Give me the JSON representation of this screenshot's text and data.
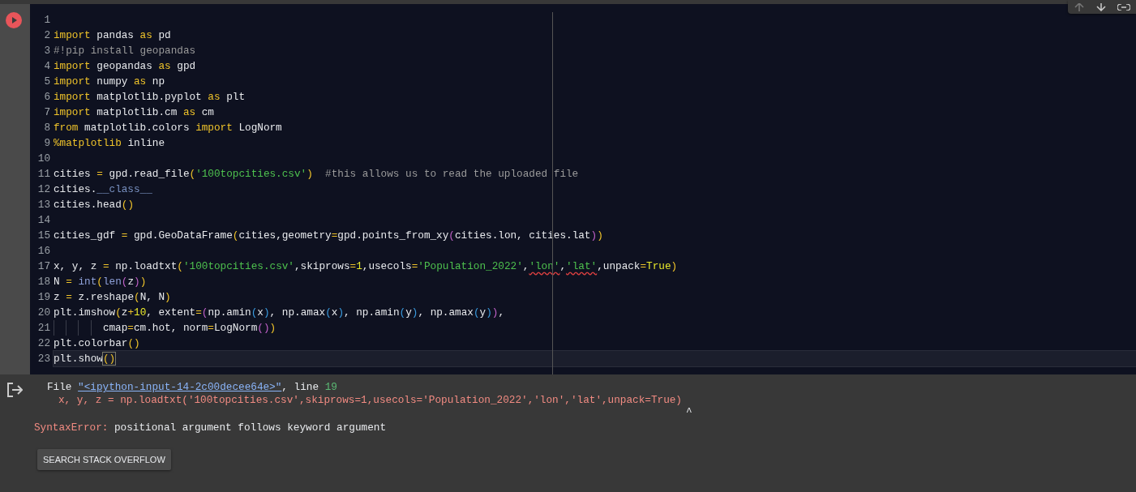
{
  "cell": {
    "code_lines": [
      {
        "number": "1",
        "current": false
      },
      {
        "number": "2",
        "current": false,
        "tokens": [
          {
            "text": "import",
            "kind": "kw"
          },
          {
            "text": " pandas ",
            "kind": "plain"
          },
          {
            "text": "as",
            "kind": "kw"
          },
          {
            "text": " pd",
            "kind": "plain"
          }
        ]
      },
      {
        "number": "3",
        "current": false,
        "tokens": [
          {
            "text": "#!pip install geopandas",
            "kind": "comment"
          }
        ]
      },
      {
        "number": "4",
        "current": false,
        "tokens": [
          {
            "text": "import",
            "kind": "kw"
          },
          {
            "text": " geopandas ",
            "kind": "plain"
          },
          {
            "text": "as",
            "kind": "kw"
          },
          {
            "text": " gpd",
            "kind": "plain"
          }
        ]
      },
      {
        "number": "5",
        "current": false,
        "tokens": [
          {
            "text": "import",
            "kind": "kw"
          },
          {
            "text": " numpy ",
            "kind": "plain"
          },
          {
            "text": "as",
            "kind": "kw"
          },
          {
            "text": " np",
            "kind": "plain"
          }
        ]
      },
      {
        "number": "6",
        "current": false,
        "tokens": [
          {
            "text": "import",
            "kind": "kw"
          },
          {
            "text": " matplotlib.pyplot ",
            "kind": "plain"
          },
          {
            "text": "as",
            "kind": "kw"
          },
          {
            "text": " plt",
            "kind": "plain"
          }
        ]
      },
      {
        "number": "7",
        "current": false,
        "tokens": [
          {
            "text": "import",
            "kind": "kw"
          },
          {
            "text": " matplotlib.cm ",
            "kind": "plain"
          },
          {
            "text": "as",
            "kind": "kw"
          },
          {
            "text": " cm",
            "kind": "plain"
          }
        ]
      },
      {
        "number": "8",
        "current": false,
        "tokens": [
          {
            "text": "from",
            "kind": "kw"
          },
          {
            "text": " matplotlib.colors ",
            "kind": "plain"
          },
          {
            "text": "import",
            "kind": "kw"
          },
          {
            "text": " LogNorm",
            "kind": "plain"
          }
        ]
      },
      {
        "number": "9",
        "current": false,
        "tokens": [
          {
            "text": "%matplotlib",
            "kind": "kw"
          },
          {
            "text": " inline",
            "kind": "plain"
          }
        ]
      },
      {
        "number": "10",
        "current": false
      },
      {
        "number": "11",
        "current": false,
        "tokens": [
          {
            "text": "cities ",
            "kind": "plain"
          },
          {
            "text": "=",
            "kind": "op"
          },
          {
            "text": " gpd.read_file",
            "kind": "plain"
          },
          {
            "text": "(",
            "kind": "p1"
          },
          {
            "text": "'100topcities.csv'",
            "kind": "string"
          },
          {
            "text": ")",
            "kind": "p1"
          },
          {
            "text": "  #this allows us to read the uploaded file",
            "kind": "comment"
          }
        ]
      },
      {
        "number": "12",
        "current": false,
        "tokens": [
          {
            "text": "cities.",
            "kind": "plain"
          },
          {
            "text": "__class__",
            "kind": "dunder"
          }
        ]
      },
      {
        "number": "13",
        "current": false,
        "tokens": [
          {
            "text": "cities.head",
            "kind": "plain"
          },
          {
            "text": "()",
            "kind": "p1"
          }
        ]
      },
      {
        "number": "14",
        "current": false
      },
      {
        "number": "15",
        "current": false,
        "tokens": [
          {
            "text": "cities_gdf ",
            "kind": "plain"
          },
          {
            "text": "=",
            "kind": "op"
          },
          {
            "text": " gpd.GeoDataFrame",
            "kind": "plain"
          },
          {
            "text": "(",
            "kind": "p1"
          },
          {
            "text": "cities,geometry",
            "kind": "plain"
          },
          {
            "text": "=",
            "kind": "op"
          },
          {
            "text": "gpd.points_from_xy",
            "kind": "plain"
          },
          {
            "text": "(",
            "kind": "p2"
          },
          {
            "text": "cities.lon, cities.lat",
            "kind": "plain"
          },
          {
            "text": ")",
            "kind": "p2"
          },
          {
            "text": ")",
            "kind": "p1"
          }
        ]
      },
      {
        "number": "16",
        "current": false
      },
      {
        "number": "17",
        "current": false,
        "tokens": [
          {
            "text": "x, y, z ",
            "kind": "plain"
          },
          {
            "text": "=",
            "kind": "op"
          },
          {
            "text": " np.loadtxt",
            "kind": "plain"
          },
          {
            "text": "(",
            "kind": "p1"
          },
          {
            "text": "'100topcities.csv'",
            "kind": "string"
          },
          {
            "text": ",skiprows",
            "kind": "plain"
          },
          {
            "text": "=",
            "kind": "op"
          },
          {
            "text": "1",
            "kind": "number"
          },
          {
            "text": ",usecols",
            "kind": "plain"
          },
          {
            "text": "=",
            "kind": "op"
          },
          {
            "text": "'Population_2022'",
            "kind": "string"
          },
          {
            "text": ",",
            "kind": "plain"
          },
          {
            "text": "'lon'",
            "kind": "error_string"
          },
          {
            "text": ",",
            "kind": "plain"
          },
          {
            "text": "'lat'",
            "kind": "error_string"
          },
          {
            "text": ",unpack",
            "kind": "plain"
          },
          {
            "text": "=",
            "kind": "op"
          },
          {
            "text": "True",
            "kind": "number"
          },
          {
            "text": ")",
            "kind": "p1"
          }
        ]
      },
      {
        "number": "18",
        "current": false,
        "tokens": [
          {
            "text": "N ",
            "kind": "plain"
          },
          {
            "text": "= ",
            "kind": "op"
          },
          {
            "text": "int",
            "kind": "builtin"
          },
          {
            "text": "(",
            "kind": "p1"
          },
          {
            "text": "len",
            "kind": "builtin"
          },
          {
            "text": "(",
            "kind": "p2"
          },
          {
            "text": "z",
            "kind": "plain"
          },
          {
            "text": ")",
            "kind": "p2"
          },
          {
            "text": ")",
            "kind": "p1"
          }
        ]
      },
      {
        "number": "19",
        "current": false,
        "tokens": [
          {
            "text": "z ",
            "kind": "plain"
          },
          {
            "text": "=",
            "kind": "op"
          },
          {
            "text": " z.reshape",
            "kind": "plain"
          },
          {
            "text": "(",
            "kind": "p1"
          },
          {
            "text": "N, N",
            "kind": "plain"
          },
          {
            "text": ")",
            "kind": "p1"
          }
        ]
      },
      {
        "number": "20",
        "current": false,
        "tokens": [
          {
            "text": "plt.imshow",
            "kind": "plain"
          },
          {
            "text": "(",
            "kind": "p1"
          },
          {
            "text": "z",
            "kind": "plain"
          },
          {
            "text": "+",
            "kind": "op"
          },
          {
            "text": "10",
            "kind": "number"
          },
          {
            "text": ", extent",
            "kind": "plain"
          },
          {
            "text": "=",
            "kind": "op"
          },
          {
            "text": "(",
            "kind": "p2"
          },
          {
            "text": "np.amin",
            "kind": "plain"
          },
          {
            "text": "(",
            "kind": "p3"
          },
          {
            "text": "x",
            "kind": "plain"
          },
          {
            "text": ")",
            "kind": "p3"
          },
          {
            "text": ", np.amax",
            "kind": "plain"
          },
          {
            "text": "(",
            "kind": "p3"
          },
          {
            "text": "x",
            "kind": "plain"
          },
          {
            "text": ")",
            "kind": "p3"
          },
          {
            "text": ", np.amin",
            "kind": "plain"
          },
          {
            "text": "(",
            "kind": "p3"
          },
          {
            "text": "y",
            "kind": "plain"
          },
          {
            "text": ")",
            "kind": "p3"
          },
          {
            "text": ", np.amax",
            "kind": "plain"
          },
          {
            "text": "(",
            "kind": "p3"
          },
          {
            "text": "y",
            "kind": "plain"
          },
          {
            "text": ")",
            "kind": "p3"
          },
          {
            "text": ")",
            "kind": "p2"
          },
          {
            "text": ",",
            "kind": "plain"
          }
        ]
      },
      {
        "number": "21",
        "current": false,
        "tokens": [
          {
            "kind": "indent"
          },
          {
            "kind": "indent"
          },
          {
            "kind": "indent"
          },
          {
            "kind": "indent"
          },
          {
            "text": "cmap",
            "kind": "plain"
          },
          {
            "text": "=",
            "kind": "op"
          },
          {
            "text": "cm.hot, norm",
            "kind": "plain"
          },
          {
            "text": "=",
            "kind": "op"
          },
          {
            "text": "LogNorm",
            "kind": "plain"
          },
          {
            "text": "()",
            "kind": "p2"
          },
          {
            "text": ")",
            "kind": "p1"
          }
        ]
      },
      {
        "number": "22",
        "current": false,
        "tokens": [
          {
            "text": "plt.colorbar",
            "kind": "plain"
          },
          {
            "text": "()",
            "kind": "p1"
          }
        ]
      },
      {
        "number": "23",
        "current": true,
        "tokens": [
          {
            "text": "plt.show",
            "kind": "plain"
          },
          {
            "text": "()",
            "kind": "match"
          }
        ]
      }
    ]
  },
  "output": {
    "file_prefix": "File ",
    "file_link": "\"<ipython-input-14-2c00decee64e>\"",
    "line_label": ", line ",
    "line_number": "19",
    "source_line": "x, y, z = np.loadtxt('100topcities.csv',skiprows=1,usecols='Population_2022','lon','lat',unpack=True)",
    "caret": "^",
    "error_type": "SyntaxError:",
    "error_message": " positional argument follows keyword argument",
    "button": "SEARCH STACK OVERFLOW"
  }
}
